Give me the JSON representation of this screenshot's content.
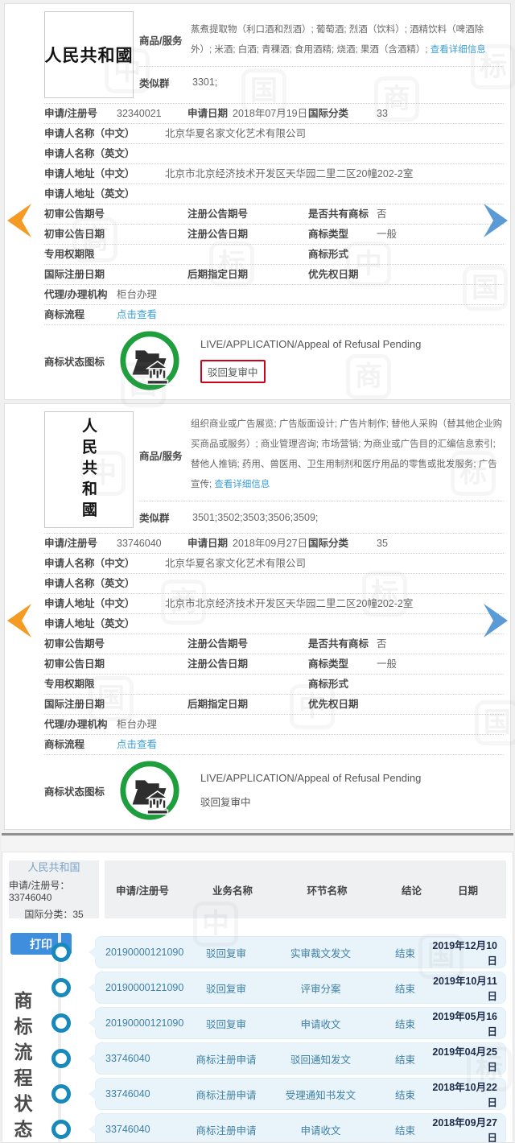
{
  "watermark": {
    "c0": "中",
    "c1": "国",
    "c2": "商",
    "c3": "标"
  },
  "labels": {
    "goods": "商品/服务",
    "similar_group": "类似群",
    "app_no": "申请/注册号",
    "app_date": "申请日期",
    "intl_class": "国际分类",
    "applicant_cn": "申请人名称（中文）",
    "applicant_en": "申请人名称（英文）",
    "address_cn": "申请人地址（中文）",
    "address_en": "申请人地址（英文）",
    "first_notice_no": "初审公告期号",
    "reg_notice_no": "注册公告期号",
    "shared_tm": "是否共有商标",
    "first_notice_date": "初审公告日期",
    "reg_notice_date": "注册公告日期",
    "tm_type": "商标类型",
    "exclusive_period": "专用权期限",
    "tm_form": "商标形式",
    "intl_reg_date": "国际注册日期",
    "late_designation_date": "后期指定日期",
    "priority_date": "优先权日期",
    "agency": "代理/办理机构",
    "tm_process": "商标流程",
    "tm_status_icon": "商标状态图标"
  },
  "cards": [
    {
      "tm_text": "人民共和國",
      "goods": "蒸煮提取物（利口酒和烈酒）; 葡萄酒; 烈酒（饮料）; 酒精饮料（啤酒除外）; 米酒; 白酒; 青稞酒; 食用酒精; 烧酒; 果酒（含酒精）; ",
      "goods_link": "查看详细信息",
      "similar_group": "3301;",
      "app_no": "32340021",
      "app_date": "2018年07月19日",
      "intl_class": "33",
      "applicant_cn": "北京华夏名家文化艺术有限公司",
      "applicant_en": "",
      "address_cn": "北京市北京经济技术开发区天华园二里二区20幢202-2室",
      "address_en": "",
      "shared_tm": "否",
      "tm_type": "一般",
      "agency": "柜台办理",
      "process_link": "点击查看",
      "status_en": "LIVE/APPLICATION/Appeal of Refusal Pending",
      "status_cn": "驳回复审中"
    },
    {
      "tm_text": "人民共和國",
      "goods": "组织商业或广告展览; 广告版面设计; 广告片制作; 替他人采购（替其他企业购买商品或服务）; 商业管理咨询; 市场营销; 为商业或广告目的汇编信息索引; 替他人推销; 药用、兽医用、卫生用制剂和医疗用品的零售或批发服务; 广告宣传; ",
      "goods_link": "查看详细信息",
      "similar_group": "3501;3502;3503;3506;3509;",
      "app_no": "33746040",
      "app_date": "2018年09月27日",
      "intl_class": "35",
      "applicant_cn": "北京华夏名家文化艺术有限公司",
      "applicant_en": "",
      "address_cn": "北京市北京经济技术开发区天华园二里二区20幢202-2室",
      "address_en": "",
      "shared_tm": "否",
      "tm_type": "一般",
      "agency": "柜台办理",
      "process_link": "点击查看",
      "status_en": "LIVE/APPLICATION/Appeal of Refusal Pending",
      "status_cn": "驳回复审中"
    }
  ],
  "panel": {
    "tm_name": "人民共和国",
    "app_no_line": "申请/注册号：33746040",
    "class_line": "国际分类：35",
    "print_label": "打印",
    "side_text": "商标流程状态",
    "headers": [
      "申请/注册号",
      "业务名称",
      "环节名称",
      "结论",
      "日期"
    ],
    "rows": [
      {
        "no": "20190000121090",
        "biz": "驳回复审",
        "step": "实审裁文发文",
        "result": "结束",
        "date": "2019年12月10日"
      },
      {
        "no": "20190000121090",
        "biz": "驳回复审",
        "step": "评审分案",
        "result": "结束",
        "date": "2019年10月11日"
      },
      {
        "no": "20190000121090",
        "biz": "驳回复审",
        "step": "申请收文",
        "result": "结束",
        "date": "2019年05月16日"
      },
      {
        "no": "33746040",
        "biz": "商标注册申请",
        "step": "驳回通知发文",
        "result": "结束",
        "date": "2019年04月25日"
      },
      {
        "no": "33746040",
        "biz": "商标注册申请",
        "step": "受理通知书发文",
        "result": "结束",
        "date": "2018年10月22日"
      },
      {
        "no": "33746040",
        "biz": "商标注册申请",
        "step": "申请收文",
        "result": "结束",
        "date": "2018年09月27日"
      }
    ]
  }
}
